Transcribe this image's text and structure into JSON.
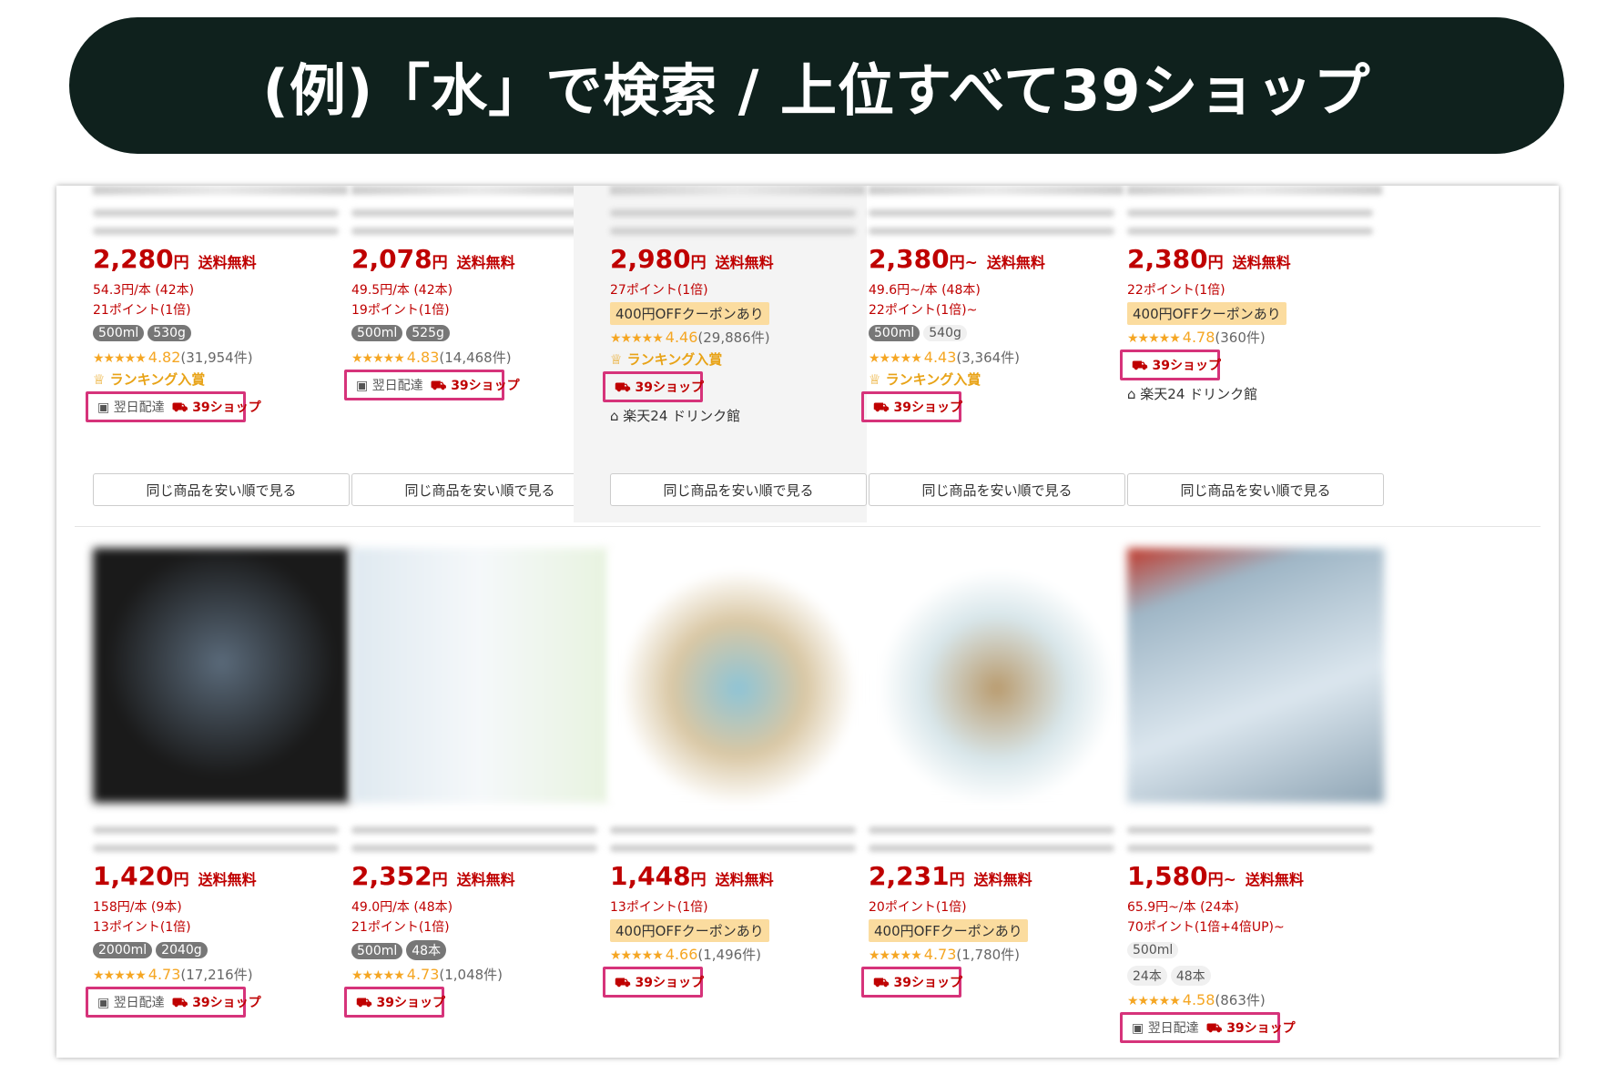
{
  "banner": {
    "title": "(例)「水」で検索 / 上位すべて39ショップ"
  },
  "labels": {
    "compare_button": "同じ商品を安い順で見る",
    "delivery": "翌日配達",
    "shop39": "39ショップ",
    "ranking": "ランキング入賞",
    "coupon": "400円OFFクーポンあり",
    "shipping": "送料無料"
  },
  "row1": [
    {
      "price": "2,280",
      "yen": "円",
      "shipping": "送料無料",
      "lines": [
        "54.3円/本 (42本)",
        "21ポイント(1倍)"
      ],
      "tags": [
        {
          "t": "500ml",
          "d": true
        },
        {
          "t": "530g",
          "d": true
        }
      ],
      "stars": "★★★★★",
      "rating": "4.82",
      "count": "(31,954件)",
      "ranking": true,
      "delivery": true,
      "store": ""
    },
    {
      "price": "2,078",
      "yen": "円",
      "shipping": "送料無料",
      "lines": [
        "49.5円/本 (42本)",
        "19ポイント(1倍)"
      ],
      "tags": [
        {
          "t": "500ml",
          "d": true
        },
        {
          "t": "525g",
          "d": true
        }
      ],
      "stars": "★★★★★",
      "rating": "4.83",
      "count": "(14,468件)",
      "ranking": false,
      "delivery": true,
      "store": ""
    },
    {
      "price": "2,980",
      "yen": "円",
      "shipping": "送料無料",
      "lines": [
        "27ポイント(1倍)"
      ],
      "coupon": true,
      "tags": [],
      "stars": "★★★★★",
      "rating": "4.46",
      "count": "(29,886件)",
      "ranking": true,
      "delivery": false,
      "store": "楽天24 ドリンク館"
    },
    {
      "price": "2,380",
      "yen": "円~",
      "shipping": "送料無料",
      "lines": [
        "49.6円~/本 (48本)",
        "22ポイント(1倍)~"
      ],
      "tags": [
        {
          "t": "500ml",
          "d": true
        },
        {
          "t": "540g",
          "d": false
        }
      ],
      "stars": "★★★★★",
      "rating": "4.43",
      "count": "(3,364件)",
      "ranking": true,
      "delivery": false,
      "store": ""
    },
    {
      "price": "2,380",
      "yen": "円",
      "shipping": "送料無料",
      "lines": [
        "22ポイント(1倍)"
      ],
      "coupon": true,
      "tags": [],
      "stars": "★★★★★",
      "rating": "4.78",
      "count": "(360件)",
      "ranking": false,
      "delivery": false,
      "store": "楽天24 ドリンク館"
    }
  ],
  "row2": [
    {
      "price": "1,420",
      "yen": "円",
      "shipping": "送料無料",
      "lines": [
        "158円/本 (9本)",
        "13ポイント(1倍)"
      ],
      "tags": [
        {
          "t": "2000ml",
          "d": true
        },
        {
          "t": "2040g",
          "d": true
        }
      ],
      "stars": "★★★★★",
      "rating": "4.73",
      "count": "(17,216件)",
      "delivery": true
    },
    {
      "price": "2,352",
      "yen": "円",
      "shipping": "送料無料",
      "lines": [
        "49.0円/本 (48本)",
        "21ポイント(1倍)"
      ],
      "tags": [
        {
          "t": "500ml",
          "d": true
        },
        {
          "t": "48本",
          "d": true
        }
      ],
      "stars": "★★★★★",
      "rating": "4.73",
      "count": "(1,048件)",
      "delivery": false
    },
    {
      "price": "1,448",
      "yen": "円",
      "shipping": "送料無料",
      "lines": [
        "13ポイント(1倍)"
      ],
      "coupon": true,
      "tags": [],
      "stars": "★★★★★",
      "rating": "4.66",
      "count": "(1,496件)",
      "delivery": false
    },
    {
      "price": "2,231",
      "yen": "円",
      "shipping": "送料無料",
      "lines": [
        "20ポイント(1倍)"
      ],
      "coupon": true,
      "tags": [],
      "stars": "★★★★★",
      "rating": "4.73",
      "count": "(1,780件)",
      "delivery": false
    },
    {
      "price": "1,580",
      "yen": "円~",
      "shipping": "送料無料",
      "lines": [
        "65.9円~/本 (24本)",
        "70ポイント(1倍+4倍UP)~"
      ],
      "tags": [
        {
          "t": "500ml",
          "d": false
        }
      ],
      "tags2": [
        {
          "t": "24本",
          "d": false
        },
        {
          "t": "48本",
          "d": false
        }
      ],
      "stars": "★★★★★",
      "rating": "4.58",
      "count": "(863件)",
      "delivery": true
    }
  ]
}
